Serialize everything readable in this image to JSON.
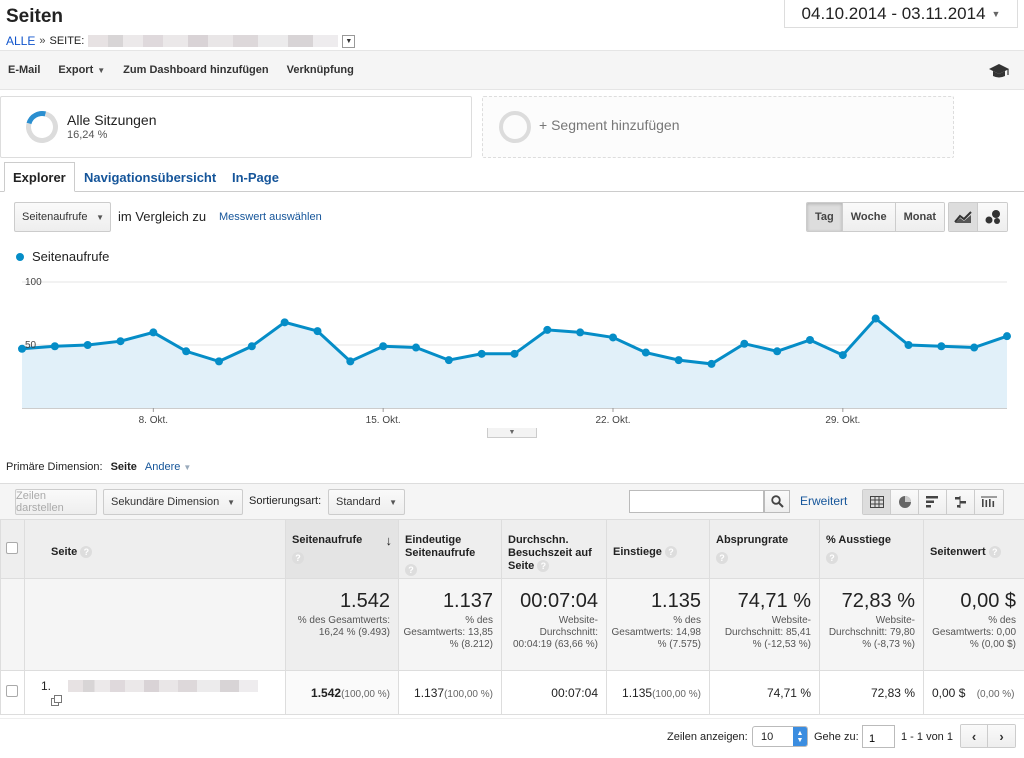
{
  "header": {
    "title": "Seiten",
    "breadcrumb_all": "ALLE",
    "breadcrumb_sep": "»",
    "breadcrumb_seite": "SEITE:",
    "date_range": "04.10.2014 - 03.11.2014"
  },
  "toolbar": {
    "email": "E-Mail",
    "export": "Export",
    "dashboard": "Zum Dashboard hinzufügen",
    "link": "Verknüpfung"
  },
  "segments": {
    "seg1_name": "Alle Sitzungen",
    "seg1_pct": "16,24 %",
    "seg1_share": 0.1624,
    "seg2_name": "+ Segment hinzufügen"
  },
  "tabs": [
    "Explorer",
    "Navigationsübersicht",
    "In-Page"
  ],
  "controls": {
    "metric": "Seitenaufrufe",
    "compare": "im Vergleich zu",
    "select_metric": "Messwert auswählen",
    "periods": [
      "Tag",
      "Woche",
      "Monat"
    ],
    "active_period": "Tag"
  },
  "chart_data": {
    "type": "area",
    "series": [
      {
        "name": "Seitenaufrufe",
        "color": "#058dc7",
        "values": [
          47,
          49,
          50,
          53,
          60,
          45,
          37,
          49,
          68,
          61,
          37,
          49,
          48,
          38,
          43,
          43,
          62,
          60,
          56,
          44,
          38,
          35,
          51,
          45,
          54,
          42,
          71,
          50,
          49,
          48,
          57
        ]
      }
    ],
    "x": [
      "04.10",
      "05.10",
      "06.10",
      "07.10",
      "08.10",
      "09.10",
      "10.10",
      "11.10",
      "12.10",
      "13.10",
      "14.10",
      "15.10",
      "16.10",
      "17.10",
      "18.10",
      "19.10",
      "20.10",
      "21.10",
      "22.10",
      "23.10",
      "24.10",
      "25.10",
      "26.10",
      "27.10",
      "28.10",
      "29.10",
      "30.10",
      "31.10",
      "01.11",
      "02.11",
      "03.11"
    ],
    "ytick_labels": [
      "100",
      "50"
    ],
    "xtick_labels": [
      "8. Okt.",
      "15. Okt.",
      "22. Okt.",
      "29. Okt."
    ],
    "ylim": [
      0,
      100
    ],
    "grid": true
  },
  "dimension": {
    "label": "Primäre Dimension:",
    "current": "Seite",
    "other": "Andere"
  },
  "table_controls": {
    "show_rows": "Zeilen darstellen",
    "secondary": "Sekundäre Dimension",
    "sort_label": "Sortierungsart:",
    "sort_value": "Standard",
    "search_placeholder": "",
    "advanced": "Erweitert"
  },
  "table": {
    "columns": [
      "Seite",
      "Seitenaufrufe",
      "Eindeutige Seitenaufrufe",
      "Durchschn. Besuchszeit auf Seite",
      "Einstiege",
      "Absprungrate",
      "% Ausstiege",
      "Seitenwert"
    ],
    "totals": [
      {
        "value": "1.542",
        "sub": "% des Gesamtwerts: 16,24 % (9.493)"
      },
      {
        "value": "1.137",
        "sub": "% des Gesamtwerts: 13,85 % (8.212)"
      },
      {
        "value": "00:07:04",
        "sub": "Website-Durchschnitt: 00:04:19 (63,66 %)"
      },
      {
        "value": "1.135",
        "sub": "% des Gesamtwerts: 14,98 % (7.575)"
      },
      {
        "value": "74,71 %",
        "sub": "Website-Durchschnitt: 85,41 % (-12,53 %)"
      },
      {
        "value": "72,83 %",
        "sub": "Website-Durchschnitt: 79,80 % (-8,73 %)"
      },
      {
        "value": "0,00 $",
        "sub": "% des Gesamtwerts: 0,00 % (0,00 $)"
      }
    ],
    "rows": [
      {
        "index": "1.",
        "pageviews": "1.542",
        "pageviews_pct": "(100,00 %)",
        "unique": "1.137",
        "unique_pct": "(100,00 %)",
        "time": "00:07:04",
        "entrances": "1.135",
        "entrances_pct": "(100,00 %)",
        "bounce": "74,71 %",
        "exit": "72,83 %",
        "value": "0,00 $",
        "value_pct": "(0,00 %)"
      }
    ]
  },
  "footer": {
    "show_rows_label": "Zeilen anzeigen:",
    "rows_value": "10",
    "goto_label": "Gehe zu:",
    "goto_value": "1",
    "range": "1 - 1 von 1"
  }
}
